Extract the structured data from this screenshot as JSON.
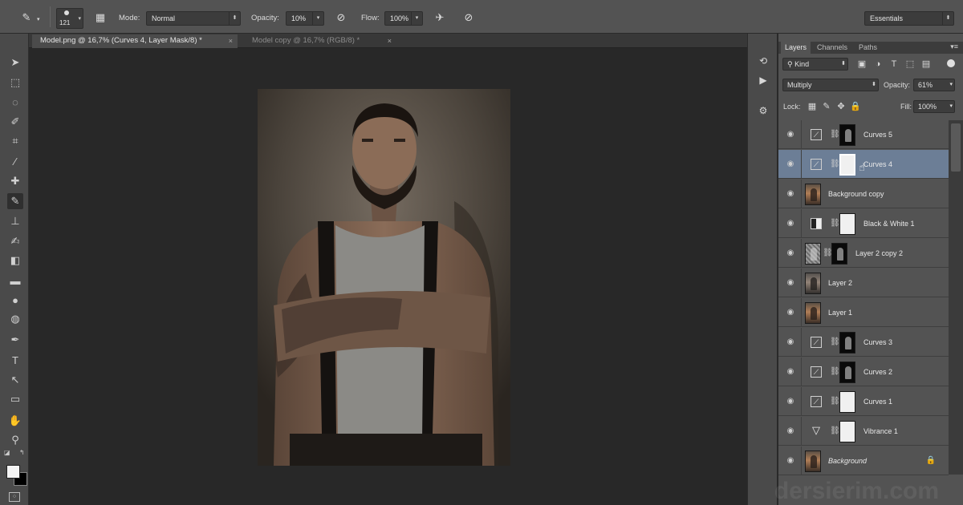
{
  "options": {
    "brush_size": "121",
    "mode_label": "Mode:",
    "mode_value": "Normal",
    "opacity_label": "Opacity:",
    "opacity_value": "10%",
    "flow_label": "Flow:",
    "flow_value": "100%",
    "workspace": "Essentials"
  },
  "tabs": [
    {
      "label": "Model.png @ 16,7% (Curves 4, Layer Mask/8) *",
      "close": "×"
    },
    {
      "label": "Model copy @ 16,7% (RGB/8) *",
      "close": "×"
    }
  ],
  "panel": {
    "tabs": [
      "Layers",
      "Channels",
      "Paths"
    ],
    "filter_kind": "Kind",
    "blend_mode": "Multiply",
    "opacity_label": "Opacity:",
    "opacity_value": "61%",
    "lock_label": "Lock:",
    "fill_label": "Fill:",
    "fill_value": "100%"
  },
  "layers": [
    {
      "name": "Curves 5",
      "type": "curves",
      "mask": "black",
      "selected": false
    },
    {
      "name": "Curves 4",
      "type": "curves",
      "mask": "white",
      "selected": true
    },
    {
      "name": "Background copy",
      "type": "photo",
      "mask": "",
      "selected": false
    },
    {
      "name": "Black & White 1",
      "type": "bw",
      "mask": "white",
      "selected": false
    },
    {
      "name": "Layer 2 copy 2",
      "type": "gray",
      "mask": "black",
      "selected": false
    },
    {
      "name": "Layer 2",
      "type": "photo",
      "mask": "",
      "selected": false
    },
    {
      "name": "Layer 1",
      "type": "photo",
      "mask": "",
      "selected": false
    },
    {
      "name": "Curves 3",
      "type": "curves",
      "mask": "black",
      "selected": false
    },
    {
      "name": "Curves 2",
      "type": "curves",
      "mask": "black",
      "selected": false
    },
    {
      "name": "Curves 1",
      "type": "curves",
      "mask": "white",
      "selected": false
    },
    {
      "name": "Vibrance 1",
      "type": "vibrance",
      "mask": "white",
      "selected": false
    },
    {
      "name": "Background",
      "type": "photo",
      "mask": "",
      "selected": false,
      "italic": true,
      "locked": true
    }
  ],
  "watermark": "dersierim.com"
}
